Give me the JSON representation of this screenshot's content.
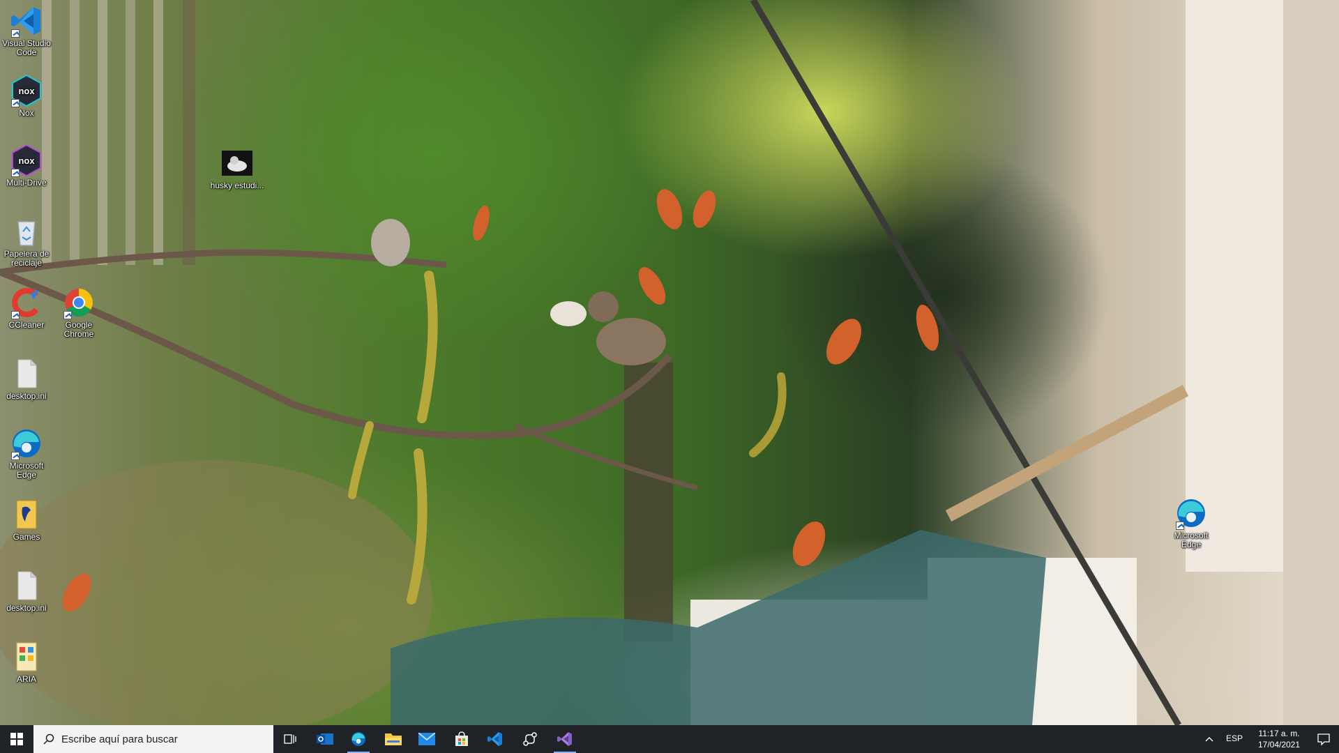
{
  "desktop": {
    "icons": [
      {
        "label": "Visual Studio Code",
        "icon": "vscode-icon"
      },
      {
        "label": "Nox",
        "icon": "nox-icon"
      },
      {
        "label": "Multi-Drive",
        "icon": "nox-multidrive-icon"
      },
      {
        "label": "Papelera de reciclaje",
        "icon": "recycle-bin-icon"
      },
      {
        "label": "CCleaner",
        "icon": "ccleaner-icon"
      },
      {
        "label": "Google Chrome",
        "icon": "chrome-icon"
      },
      {
        "label": "desktop.ini",
        "icon": "file-icon"
      },
      {
        "label": "Microsoft Edge",
        "icon": "edge-icon"
      },
      {
        "label": "Games",
        "icon": "games-folder-icon"
      },
      {
        "label": "desktop.ini",
        "icon": "file-icon"
      },
      {
        "label": "ARIA",
        "icon": "aria-icon"
      },
      {
        "label": "husky estudi...",
        "icon": "husky-image-icon"
      },
      {
        "label": "Microsoft Edge",
        "icon": "edge-icon"
      }
    ]
  },
  "taskbar": {
    "search_placeholder": "Escribe aquí para buscar",
    "pinned": [
      {
        "name": "task-view",
        "icon": "task-view-icon"
      },
      {
        "name": "outlook",
        "icon": "outlook-icon"
      },
      {
        "name": "edge",
        "icon": "edge-icon"
      },
      {
        "name": "file-explorer",
        "icon": "folder-icon"
      },
      {
        "name": "mail",
        "icon": "mail-icon"
      },
      {
        "name": "store",
        "icon": "store-icon"
      },
      {
        "name": "vscode",
        "icon": "vscode-icon"
      },
      {
        "name": "git-tool",
        "icon": "git-icon"
      },
      {
        "name": "visual-studio",
        "icon": "visual-studio-icon"
      }
    ],
    "language": "ESP",
    "time": "11:17 a. m.",
    "date": "17/04/2021"
  },
  "colors": {
    "taskbar_bg": "#1f2327",
    "accent_blue": "#1b7fd6",
    "vs_purple": "#865fc5"
  }
}
